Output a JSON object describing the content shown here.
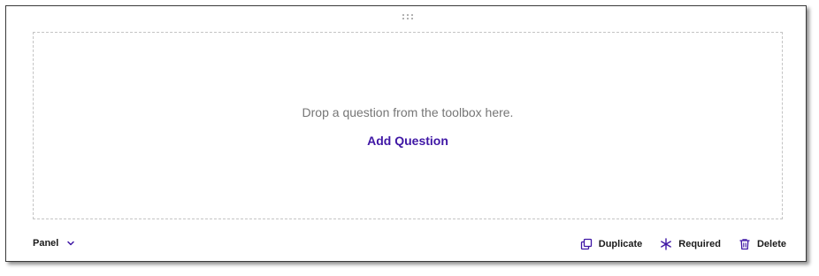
{
  "drop_zone": {
    "message": "Drop a question from the toolbox here.",
    "add_label": "Add Question"
  },
  "footer": {
    "panel_type_label": "Panel",
    "actions": {
      "duplicate_label": "Duplicate",
      "required_label": "Required",
      "delete_label": "Delete"
    }
  },
  "icons": {
    "drag": "drag-handle-icon",
    "chevron": "chevron-down-icon",
    "duplicate": "duplicate-icon",
    "required": "asterisk-icon",
    "delete": "trash-icon"
  },
  "colors": {
    "accent": "#3f17a5",
    "muted_text": "#767676",
    "dashed_border": "#c4c4c4"
  }
}
